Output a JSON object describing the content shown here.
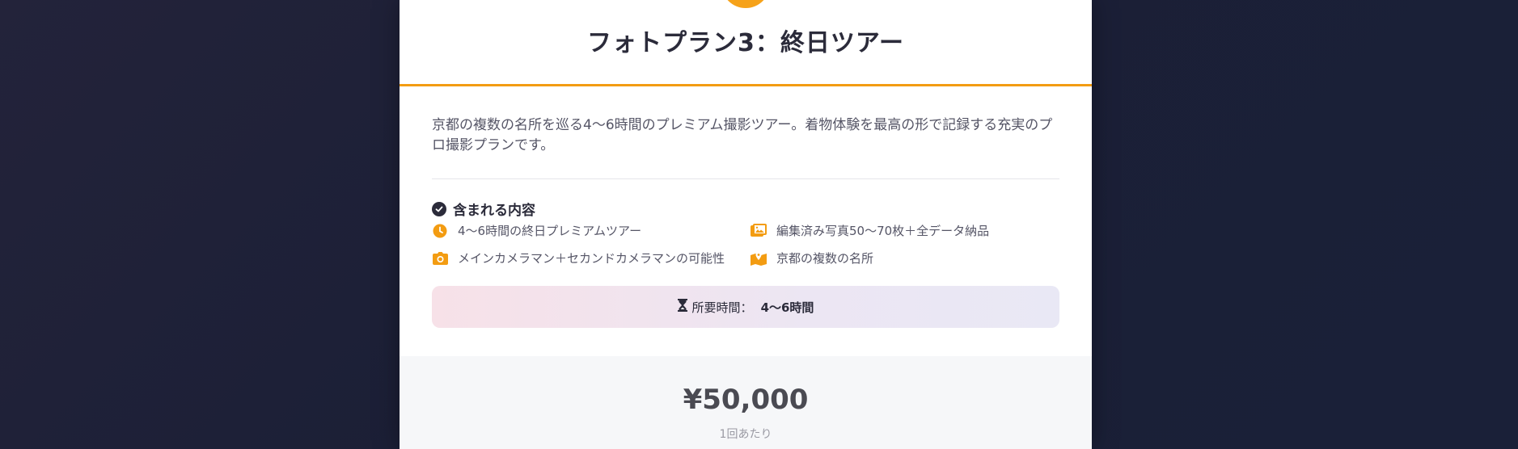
{
  "plan": {
    "title": "フォトプラン3：終日ツアー",
    "description": "京都の複数の名所を巡る4〜6時間のプレミアム撮影ツアー。着物体験を最高の形で記録する充実のプロ撮影プランです。"
  },
  "included": {
    "title": "含まれる内容",
    "icon": "check-circle-icon",
    "items": [
      {
        "icon": "clock-icon",
        "label": "4〜6時間の終日プレミアムツアー"
      },
      {
        "icon": "images-icon",
        "label": "編集済み写真50〜70枚＋全データ納品"
      },
      {
        "icon": "camera-icon",
        "label": "メインカメラマン＋セカンドカメラマンの可能性"
      },
      {
        "icon": "map-location-icon",
        "label": "京都の複数の名所"
      }
    ]
  },
  "duration": {
    "icon": "hourglass-icon",
    "label": "所要時間：",
    "value": "4〜6時間"
  },
  "pricing": {
    "price": "¥50,000",
    "unit": "1回あたり"
  },
  "colors": {
    "accent": "#f39c12",
    "text_dark": "#2b2b3a",
    "text_body": "#555566"
  }
}
